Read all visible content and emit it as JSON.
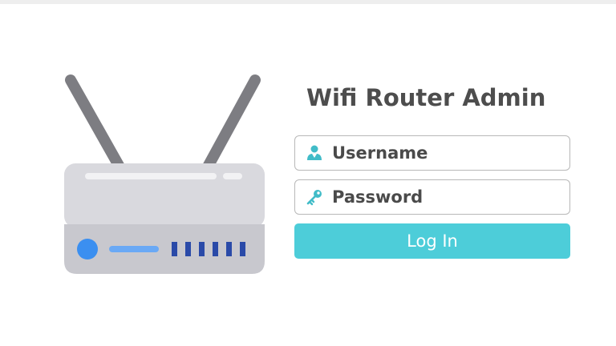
{
  "header": {
    "title": "Wifi Router Admin"
  },
  "form": {
    "username": {
      "placeholder": "Username",
      "value": "",
      "icon": "user-icon"
    },
    "password": {
      "placeholder": "Password",
      "value": "",
      "icon": "key-icon"
    },
    "login_label": "Log In"
  },
  "illustration": {
    "icon": "router-icon",
    "status_led_count": 6
  },
  "colors": {
    "accent": "#4dcdd9",
    "router_body": "#d9d9de",
    "router_front": "#c8c8ce",
    "antenna": "#7d7d82",
    "power_led": "#3b8ff0",
    "status_led": "#2a4aa8",
    "title_text": "#4d4d4d"
  }
}
